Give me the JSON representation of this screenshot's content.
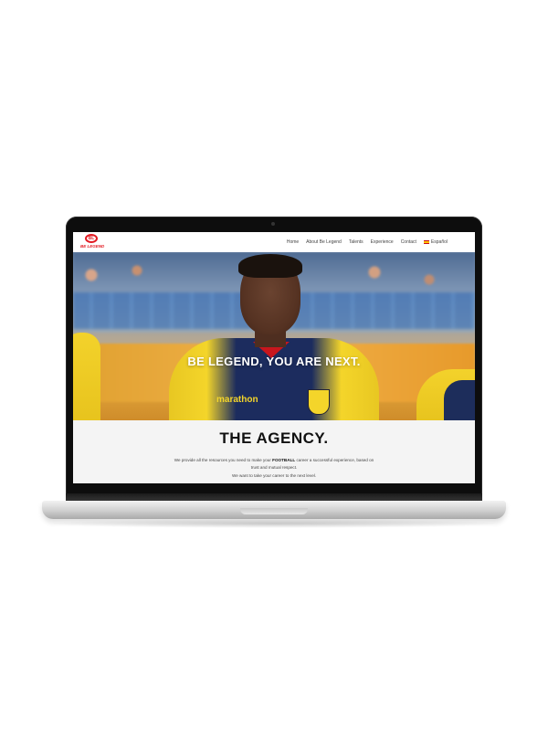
{
  "nav": {
    "logo_initials": "BL",
    "logo_text": "BE LEGEND",
    "links": [
      "Home",
      "About Be Legend",
      "Talents",
      "Experience",
      "Contact"
    ],
    "language": "Español"
  },
  "hero": {
    "tagline": "BE LEGEND, YOU ARE NEXT.",
    "sponsor": "marathon",
    "crest_text": "FEF"
  },
  "agency": {
    "title": "THE AGENCY.",
    "body_pre": "We provide all the resources you need to make your ",
    "body_bold": "FOOTBALL",
    "body_post": " career a successful experience, based on trust and mutual respect.",
    "next_level": "We want to take your career to the next level."
  },
  "colors": {
    "brand_red": "#e21b23",
    "jersey_yellow": "#f4d52a",
    "jersey_navy": "#1c2c5e"
  }
}
